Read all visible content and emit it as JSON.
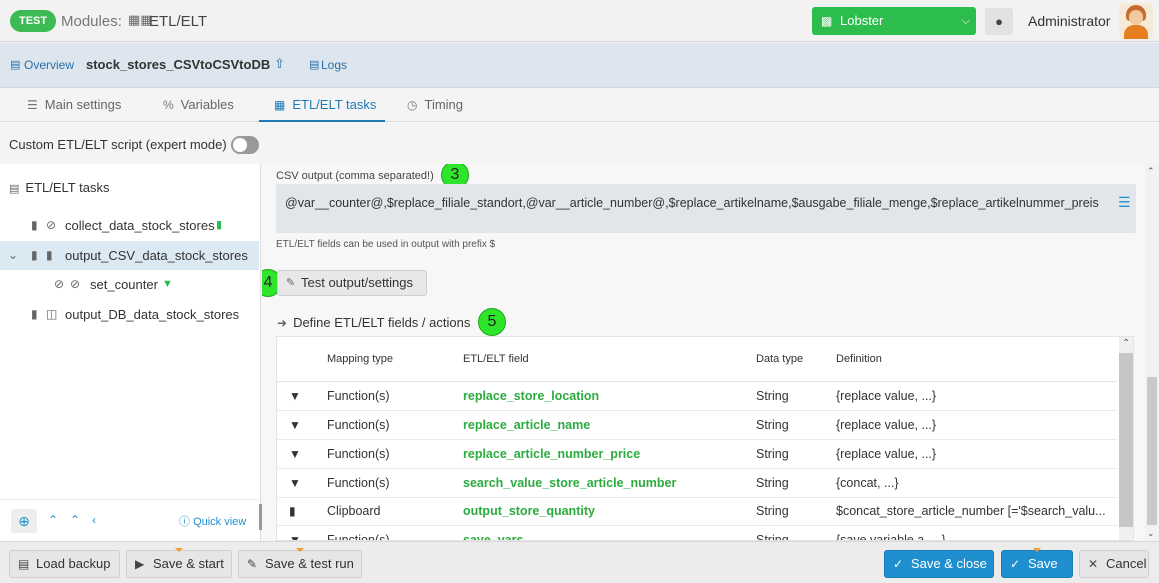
{
  "topbar": {
    "env_badge": "TEST",
    "modules_label": "Modules:",
    "module_name": "ETL/ELT",
    "instance_select": "Lobster",
    "user": "Administrator"
  },
  "breadcrumb": {
    "overview": "Overview",
    "job_name": "stock_stores_CSVtoCSVtoDB",
    "logs": "Logs"
  },
  "tabs": [
    {
      "label": "Main settings",
      "icon": "list-icon"
    },
    {
      "label": "Variables",
      "icon": "percent-icon"
    },
    {
      "label": "ETL/ELT tasks",
      "icon": "tasks-icon",
      "active": true
    },
    {
      "label": "Timing",
      "icon": "clock-icon"
    }
  ],
  "expert_mode": {
    "label": "Custom ETL/ELT script (expert mode)",
    "enabled": false
  },
  "left_panel": {
    "title": "ETL/ELT tasks",
    "tree": [
      {
        "label": "collect_data_stock_stores"
      },
      {
        "label": "output_CSV_data_stock_stores",
        "selected": true
      },
      {
        "label": "set_counter"
      },
      {
        "label": "output_DB_data_stock_stores"
      }
    ],
    "quick_view": "Quick view"
  },
  "output": {
    "csv_label": "CSV output (comma separated!)",
    "step3": "3",
    "csv_value": "@var__counter@,$replace_filiale_standort,@var__article_number@,$replace_artikelname,$ausgabe_filiale_menge,$replace_artikelnummer_preis",
    "hint": "ETL/ELT fields can be used in output with prefix $",
    "step4": "4",
    "test_button": "Test output/settings",
    "define_label": "Define ETL/ELT fields / actions",
    "step5": "5"
  },
  "table": {
    "headers": {
      "mapping": "Mapping type",
      "field": "ETL/ELT field",
      "dtype": "Data type",
      "definition": "Definition"
    },
    "rows": [
      {
        "mapping": "Function(s)",
        "field": "replace_store_location",
        "dtype": "String",
        "definition": "{replace value, ...}",
        "icon": "filter-icon"
      },
      {
        "mapping": "Function(s)",
        "field": "replace_article_name",
        "dtype": "String",
        "definition": "{replace value, ...}",
        "icon": "filter-icon"
      },
      {
        "mapping": "Function(s)",
        "field": "replace_article_number_price",
        "dtype": "String",
        "definition": "{replace value, ...}",
        "icon": "filter-icon"
      },
      {
        "mapping": "Function(s)",
        "field": "search_value_store_article_number",
        "dtype": "String",
        "definition": "{concat, ...}",
        "icon": "filter-icon"
      },
      {
        "mapping": "Clipboard",
        "field": "output_store_quantity",
        "dtype": "String",
        "definition": "$concat_store_article_number [='$search_valu...",
        "icon": "clipboard-icon"
      },
      {
        "mapping": "Function(s)",
        "field": "save_vars",
        "dtype": "String",
        "definition": "{save variable a, ...}",
        "icon": "filter-icon"
      }
    ]
  },
  "footer": {
    "load_backup": "Load backup",
    "save_start": "Save & start",
    "save_test_run": "Save & test run",
    "save_close": "Save & close",
    "save": "Save",
    "cancel": "Cancel"
  },
  "colors": {
    "accent": "#1f8fcf",
    "green": "#2cbd4d",
    "field_green": "#2cab3f",
    "step_marker": "#2ee52b"
  }
}
